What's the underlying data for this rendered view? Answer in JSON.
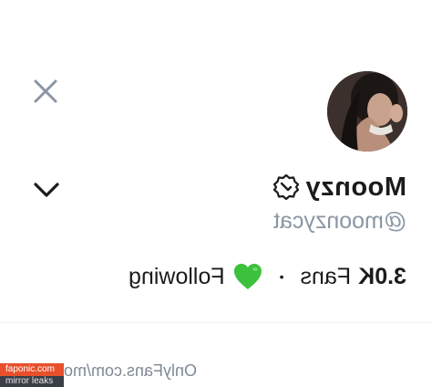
{
  "profile": {
    "display_name": "Moonzy",
    "handle": "@moonzycat",
    "fans_count": "3.0K",
    "fans_label": "Fans",
    "separator": "•",
    "following_label": "Following",
    "profile_url": "OnlyFans.com/mo"
  },
  "icons": {
    "close": "close-icon",
    "expand": "chevron-down-icon",
    "verified": "verified-badge-icon",
    "heart": "green-heart-icon",
    "avatar": "avatar-image"
  },
  "colors": {
    "text": "#1b1b1b",
    "muted": "#8a96a3",
    "icon_gray": "#8a96a3",
    "heart_green": "#3dc13c",
    "watermark_orange": "#e8502c",
    "watermark_dark": "#3a3f47"
  },
  "watermark": {
    "line1": "faponic.com",
    "line2": "mirror leaks"
  }
}
